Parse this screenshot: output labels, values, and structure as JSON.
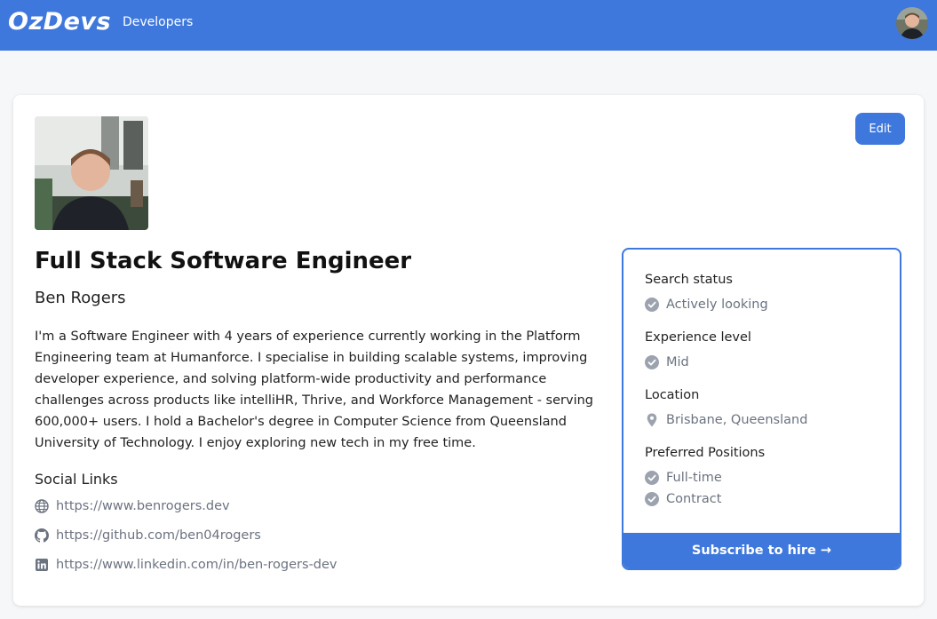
{
  "nav": {
    "logo": "OzDevs",
    "developers_link": "Developers"
  },
  "profile": {
    "edit_label": "Edit",
    "title": "Full Stack Software Engineer",
    "name": "Ben Rogers",
    "bio": "I'm a Software Engineer with 4 years of experience currently working in the Platform Engineering team at Humanforce. I specialise in building scalable systems, improving developer experience, and solving platform-wide productivity and performance challenges across products like intelliHR, Thrive, and Workforce Management - serving 600,000+ users. I hold a Bachelor's degree in Computer Science from Queensland University of Technology. I enjoy exploring new tech in my free time.",
    "social_heading": "Social Links",
    "links": [
      {
        "icon": "globe-icon",
        "url": "https://www.benrogers.dev"
      },
      {
        "icon": "github-icon",
        "url": "https://github.com/ben04rogers"
      },
      {
        "icon": "linkedin-icon",
        "url": "https://www.linkedin.com/in/ben-rogers-dev"
      }
    ]
  },
  "panel": {
    "search_status_label": "Search status",
    "search_status_value": "Actively looking",
    "experience_label": "Experience level",
    "experience_value": "Mid",
    "location_label": "Location",
    "location_value": "Brisbane, Queensland",
    "positions_label": "Preferred Positions",
    "positions": [
      "Full-time",
      "Contract"
    ],
    "subscribe_label": "Subscribe to hire →"
  },
  "colors": {
    "brand": "#3f78dc",
    "muted": "#6b7280",
    "check": "#9ca3af"
  }
}
